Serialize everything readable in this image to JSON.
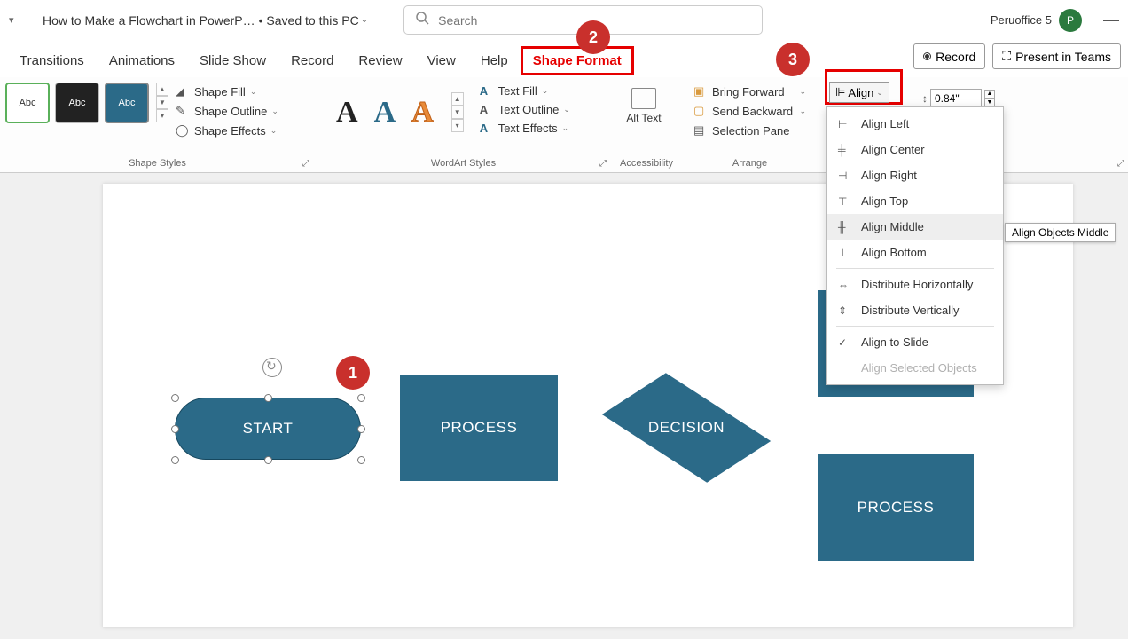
{
  "title_bar": {
    "doc_title": "How to Make a Flowchart in PowerP…",
    "saved_state": "• Saved to this PC",
    "search_placeholder": "Search",
    "user_name": "Peruoffice 5",
    "avatar_initial": "P"
  },
  "tabs": {
    "transitions": "Transitions",
    "animations": "Animations",
    "slide_show": "Slide Show",
    "record": "Record",
    "review": "Review",
    "view": "View",
    "help": "Help",
    "shape_format": "Shape Format",
    "record_btn": "Record",
    "present_teams": "Present in Teams"
  },
  "ribbon": {
    "thumb_text": "Abc",
    "shape_styles_label": "Shape Styles",
    "shape_fill": "Shape Fill",
    "shape_outline": "Shape Outline",
    "shape_effects": "Shape Effects",
    "wordart_label": "WordArt Styles",
    "text_fill": "Text Fill",
    "text_outline": "Text Outline",
    "text_effects": "Text Effects",
    "alt_text": "Alt Text",
    "accessibility_label": "Accessibility",
    "bring_forward": "Bring Forward",
    "send_backward": "Send Backward",
    "selection_pane": "Selection Pane",
    "arrange_label": "Arrange",
    "align": "Align",
    "size_value": "0.84\""
  },
  "dropdown": {
    "align_left": "Align Left",
    "align_center": "Align Center",
    "align_right": "Align Right",
    "align_top": "Align Top",
    "align_middle": "Align Middle",
    "align_bottom": "Align Bottom",
    "dist_h": "Distribute Horizontally",
    "dist_v": "Distribute Vertically",
    "align_slide": "Align to Slide",
    "align_selected": "Align Selected Objects"
  },
  "tooltip": "Align Objects Middle",
  "shapes": {
    "start": "START",
    "process1": "PROCESS",
    "decision": "DECISION",
    "process2": "PROCESS"
  },
  "callouts": {
    "c1": "1",
    "c2": "2",
    "c3": "3"
  }
}
